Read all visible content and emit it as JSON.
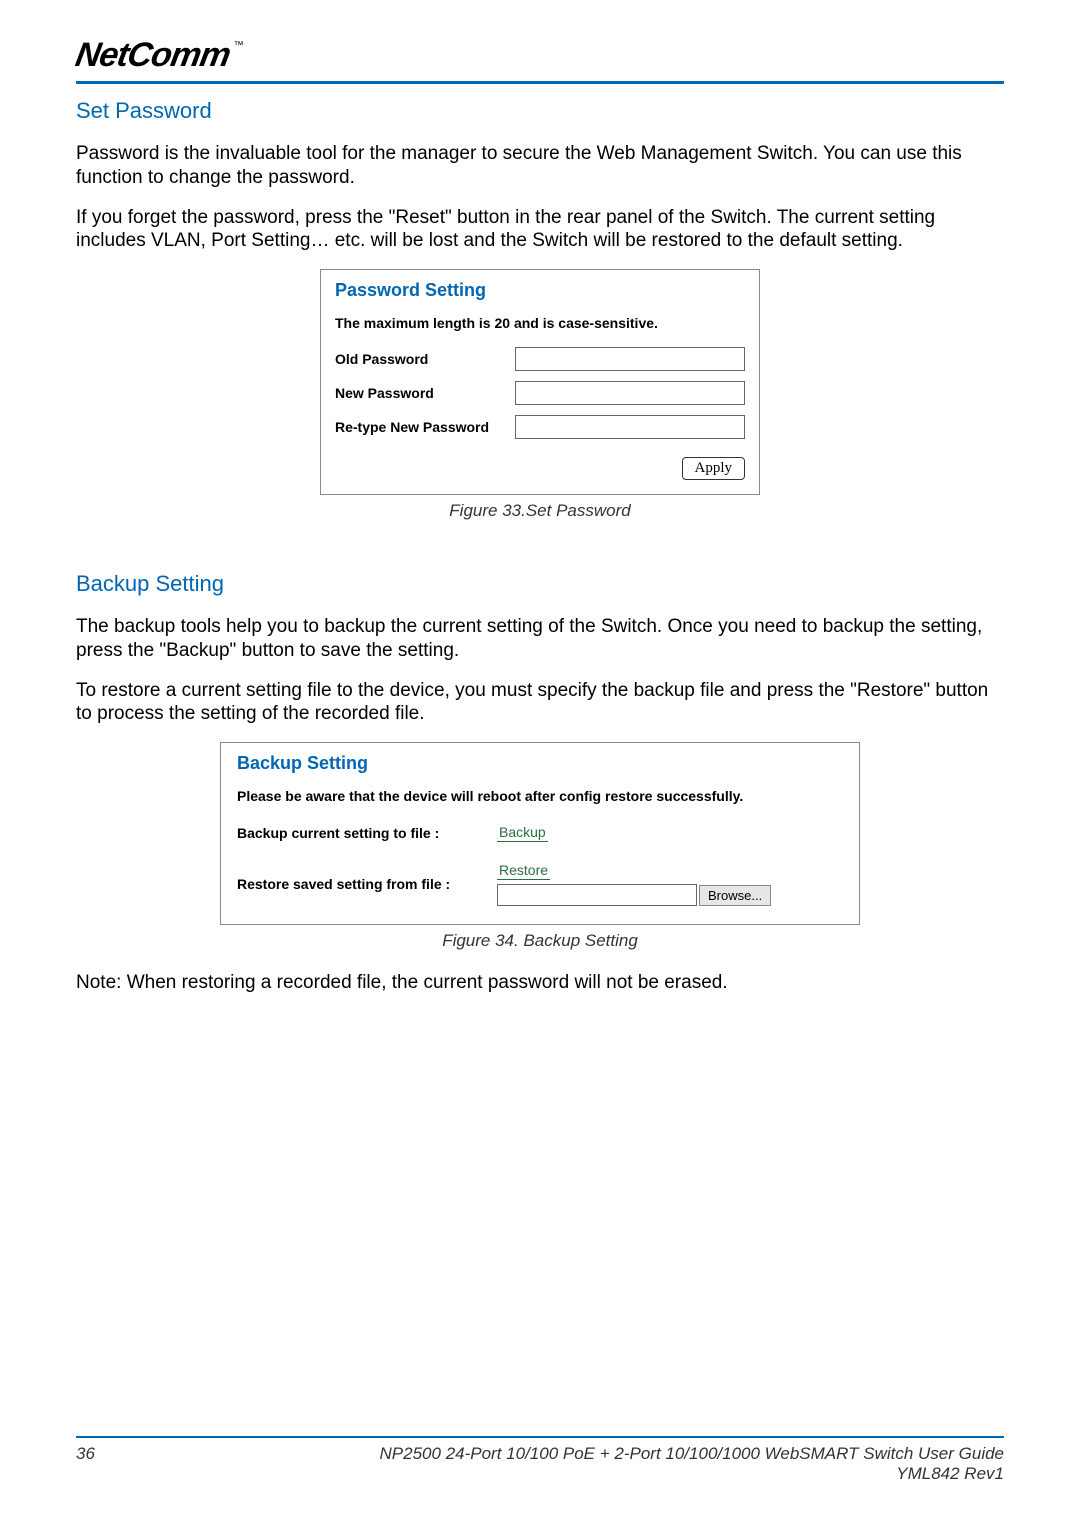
{
  "header": {
    "brand": "NetComm",
    "trademark": "™"
  },
  "section1": {
    "heading": "Set Password",
    "para1": "Password is the invaluable tool for the manager to secure the Web Management Switch. You can use this function to change the password.",
    "para2": "If you forget the password, press the \"Reset\" button in the rear panel of the Switch. The current setting includes VLAN, Port Setting… etc. will be lost and the Switch will be restored to the default setting.",
    "panel_title": "Password Setting",
    "panel_note": "The maximum length is 20 and is case-sensitive.",
    "labels": {
      "old": "Old Password",
      "new": "New Password",
      "retype": "Re-type New Password"
    },
    "apply": "Apply",
    "caption": "Figure 33.Set Password"
  },
  "section2": {
    "heading": "Backup Setting",
    "para1": "The backup tools help you to backup the current setting of the Switch. Once you need to backup the setting, press the \"Backup\" button to save the setting.",
    "para2": "To restore a current setting file to the device, you must specify the backup file and press the \"Restore\" button to process the setting of the recorded file.",
    "panel_title": "Backup Setting",
    "panel_note": "Please be aware that the device will reboot after config restore successfully.",
    "backup_label": "Backup current setting to file :",
    "backup_btn": "Backup",
    "restore_label": "Restore saved setting from file :",
    "restore_btn": "Restore",
    "browse_btn": "Browse...",
    "caption": "Figure 34. Backup Setting",
    "note": "Note: When restoring a recorded file, the current password will not be erased."
  },
  "footer": {
    "page": "36",
    "title": "NP2500 24-Port 10/100 PoE + 2-Port 10/100/1000 WebSMART Switch User Guide",
    "rev": "YML842 Rev1"
  }
}
